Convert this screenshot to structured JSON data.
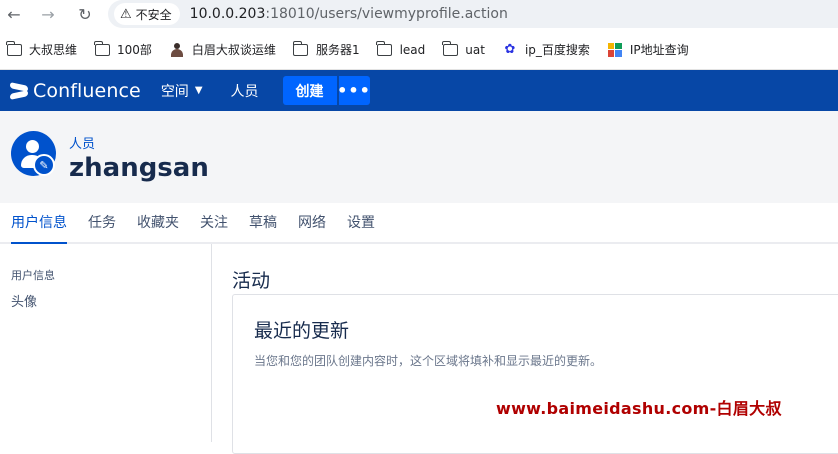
{
  "browser": {
    "back_icon": "arrow-left-icon",
    "forward_icon": "arrow-right-icon",
    "reload_icon": "reload-icon",
    "security_label": "不安全",
    "url_host": "10.0.0.203",
    "url_path": ":18010/users/viewmyprofile.action",
    "bookmarks": [
      {
        "label": "大叔思维",
        "icon": "folder-icon"
      },
      {
        "label": "100部",
        "icon": "folder-icon"
      },
      {
        "label": "白眉大叔谈运维",
        "icon": "person-icon"
      },
      {
        "label": "服务器1",
        "icon": "folder-icon"
      },
      {
        "label": "lead",
        "icon": "folder-icon"
      },
      {
        "label": "uat",
        "icon": "folder-icon"
      },
      {
        "label": "ip_百度搜索",
        "icon": "baidu-icon"
      },
      {
        "label": "IP地址查询",
        "icon": "ip-query-icon"
      }
    ]
  },
  "header": {
    "logo_text": "Confluence",
    "spaces_label": "空间",
    "people_label": "人员",
    "create_label": "创建",
    "more_label": "•••",
    "brand_color": "#0747a6",
    "button_color": "#0065ff"
  },
  "profile": {
    "breadcrumb": "人员",
    "username": "zhangsan"
  },
  "tabs": [
    {
      "label": "用户信息",
      "active": true
    },
    {
      "label": "任务"
    },
    {
      "label": "收藏夹"
    },
    {
      "label": "关注"
    },
    {
      "label": "草稿"
    },
    {
      "label": "网络"
    },
    {
      "label": "设置"
    }
  ],
  "sidebar": {
    "heading": "用户信息",
    "link": "头像"
  },
  "main": {
    "title": "活动",
    "panel_title": "最近的更新",
    "panel_desc": "当您和您的团队创建内容时，这个区域将填补和显示最近的更新。"
  },
  "watermark": "www.baimeidashu.com-白眉大叔"
}
